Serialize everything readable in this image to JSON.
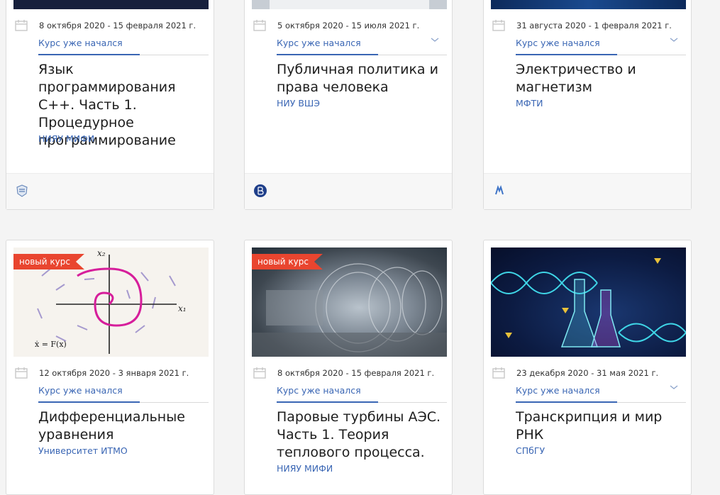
{
  "cards": [
    {
      "date": "8 октября 2020 - 15 февраля 2021 г.",
      "status": "Курс уже начался",
      "title": "Язык программирования С++. Часть 1. Процедурное программирование",
      "org": "НИЯУ МИФИ"
    },
    {
      "date": "5 октября 2020 - 15 июля 2021 г.",
      "status": "Курс уже начался",
      "title": "Публичная политика и права человека",
      "org": "НИУ ВШЭ"
    },
    {
      "date": "31 августа 2020 - 1 февраля 2021 г.",
      "status": "Курс уже начался",
      "title": "Электричество и магнетизм",
      "org": "МФТИ"
    },
    {
      "badge": "новый курс",
      "date": "12 октября 2020 - 3 января 2021 г.",
      "status": "Курс уже начался",
      "title": "Дифференциальные уравнения",
      "org": "Университет ИТМО"
    },
    {
      "badge": "новый курс",
      "date": "8 октября 2020 - 15 февраля 2021 г.",
      "status": "Курс уже начался",
      "title": "Паровые турбины АЭС. Часть 1. Теория теплового процесса.",
      "org": "НИЯУ МИФИ"
    },
    {
      "date": "23 декабря 2020 - 31 мая 2021 г.",
      "status": "Курс уже начался",
      "title": "Транскрипция и мир РНК",
      "org": "СПбГУ"
    }
  ],
  "icons": {
    "calendar": "calendar-icon",
    "chevron": "chevron-down-icon"
  }
}
